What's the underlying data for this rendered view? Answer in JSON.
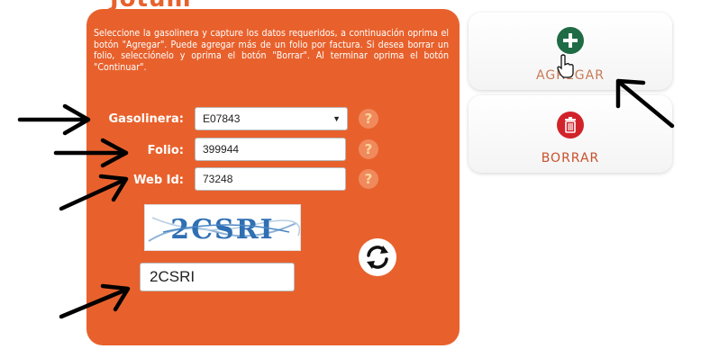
{
  "heading": "Jotum",
  "instructions": "Seleccione la gasolinera y capture los datos requeridos, a continuación oprima el botón \"Agregar\". Puede agregar más de un folio por factura. Si desea borrar un folio, selecciónelo y oprima el botón \"Borrar\". Al terminar oprima el botón \"Continuar\".",
  "form": {
    "gasolinera_label": "Gasolinera:",
    "gasolinera_value": "E07843",
    "folio_label": "Folio:",
    "folio_value": "399944",
    "webid_label": "Web Id:",
    "webid_value": "73248",
    "help_symbol": "?"
  },
  "captcha": {
    "image_text": "2CSRI",
    "input_value": "2CSRI"
  },
  "buttons": {
    "add_label": "AGREGAR",
    "delete_label": "BORRAR"
  },
  "colors": {
    "panel": "#e8612c",
    "add_circle": "#1e6b45",
    "delete_circle": "#d2232a",
    "add_text": "#c97a55",
    "delete_text": "#c9502a",
    "arrow": "#000000"
  },
  "icons": {
    "add": "plus-icon",
    "delete": "trash-icon",
    "refresh": "refresh-icon",
    "pointer": "hand-pointer-icon",
    "annotation": "arrow-icon"
  }
}
